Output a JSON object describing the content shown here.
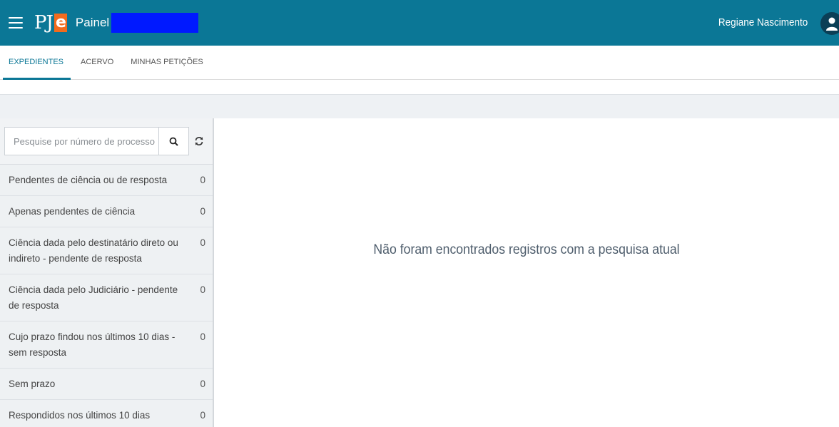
{
  "header": {
    "logo_text": "PJ",
    "logo_suffix": "e",
    "title": "Painel",
    "user_name": "Regiane Nascimento"
  },
  "tabs": [
    {
      "label": "EXPEDIENTES",
      "active": true
    },
    {
      "label": "ACERVO",
      "active": false
    },
    {
      "label": "MINHAS PETIÇÕES",
      "active": false
    }
  ],
  "sidebar": {
    "search_placeholder": "Pesquise por número de processo",
    "filters": [
      {
        "label": "Pendentes de ciência ou de resposta",
        "count": "0"
      },
      {
        "label": "Apenas pendentes de ciência",
        "count": "0"
      },
      {
        "label": "Ciência dada pelo destinatário direto ou indireto - pendente de resposta",
        "count": "0"
      },
      {
        "label": "Ciência dada pelo Judiciário - pendente de resposta",
        "count": "0"
      },
      {
        "label": "Cujo prazo findou nos últimos 10 dias - sem resposta",
        "count": "0"
      },
      {
        "label": "Sem prazo",
        "count": "0"
      },
      {
        "label": "Respondidos nos últimos 10 dias",
        "count": "0"
      }
    ]
  },
  "main": {
    "empty_message": "Não foram encontrados registros com a pesquisa atual"
  },
  "colors": {
    "header_bg": "#0b7796",
    "logo_accent": "#f26b1d",
    "redaction": "#0019ff",
    "active_tab": "#0b7796"
  }
}
